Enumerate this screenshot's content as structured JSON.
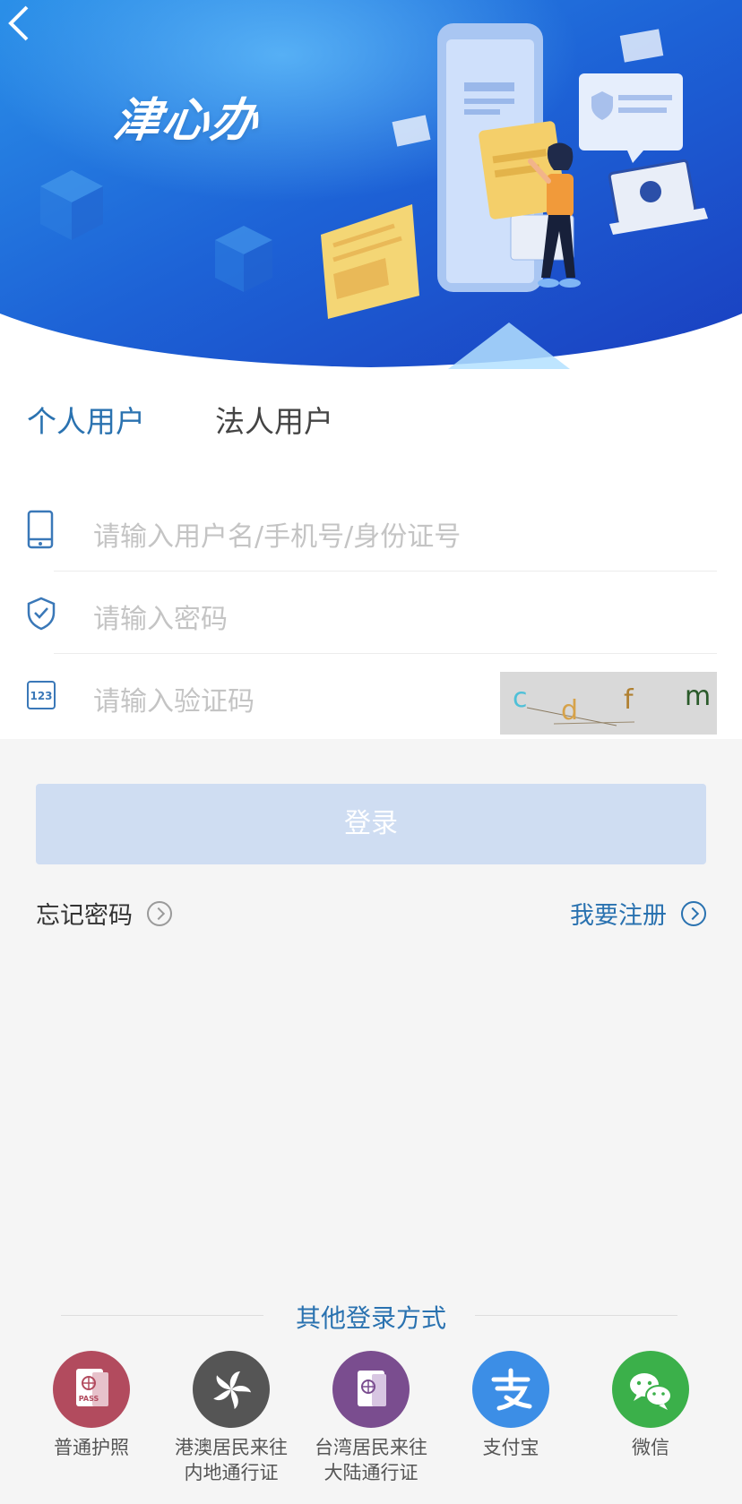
{
  "header": {
    "brand_text": "津心办"
  },
  "tabs": {
    "personal": "个人用户",
    "legal": "法人用户"
  },
  "form": {
    "username_placeholder": "请输入用户名/手机号/身份证号",
    "password_placeholder": "请输入密码",
    "captcha_placeholder": "请输入验证码",
    "captcha_chars": [
      "c",
      "d",
      "f",
      "m"
    ]
  },
  "actions": {
    "login_label": "登录",
    "forgot_label": "忘记密码",
    "register_label": "我要注册"
  },
  "other_login": {
    "title": "其他登录方式",
    "methods": [
      {
        "line1": "普通护照",
        "line2": ""
      },
      {
        "line1": "港澳居民来往",
        "line2": "内地通行证"
      },
      {
        "line1": "台湾居民来往",
        "line2": "大陆通行证"
      },
      {
        "line1": "支付宝",
        "line2": ""
      },
      {
        "line1": "微信",
        "line2": ""
      }
    ],
    "passport_badge": "PASS"
  },
  "colors": {
    "accent": "#2a72b0",
    "login_disabled": "#cfddf2",
    "passport": "#b24b5e",
    "hk": "#555555",
    "tw": "#7a4d8f",
    "alipay": "#3c8ee6",
    "wechat": "#3bb04a"
  }
}
